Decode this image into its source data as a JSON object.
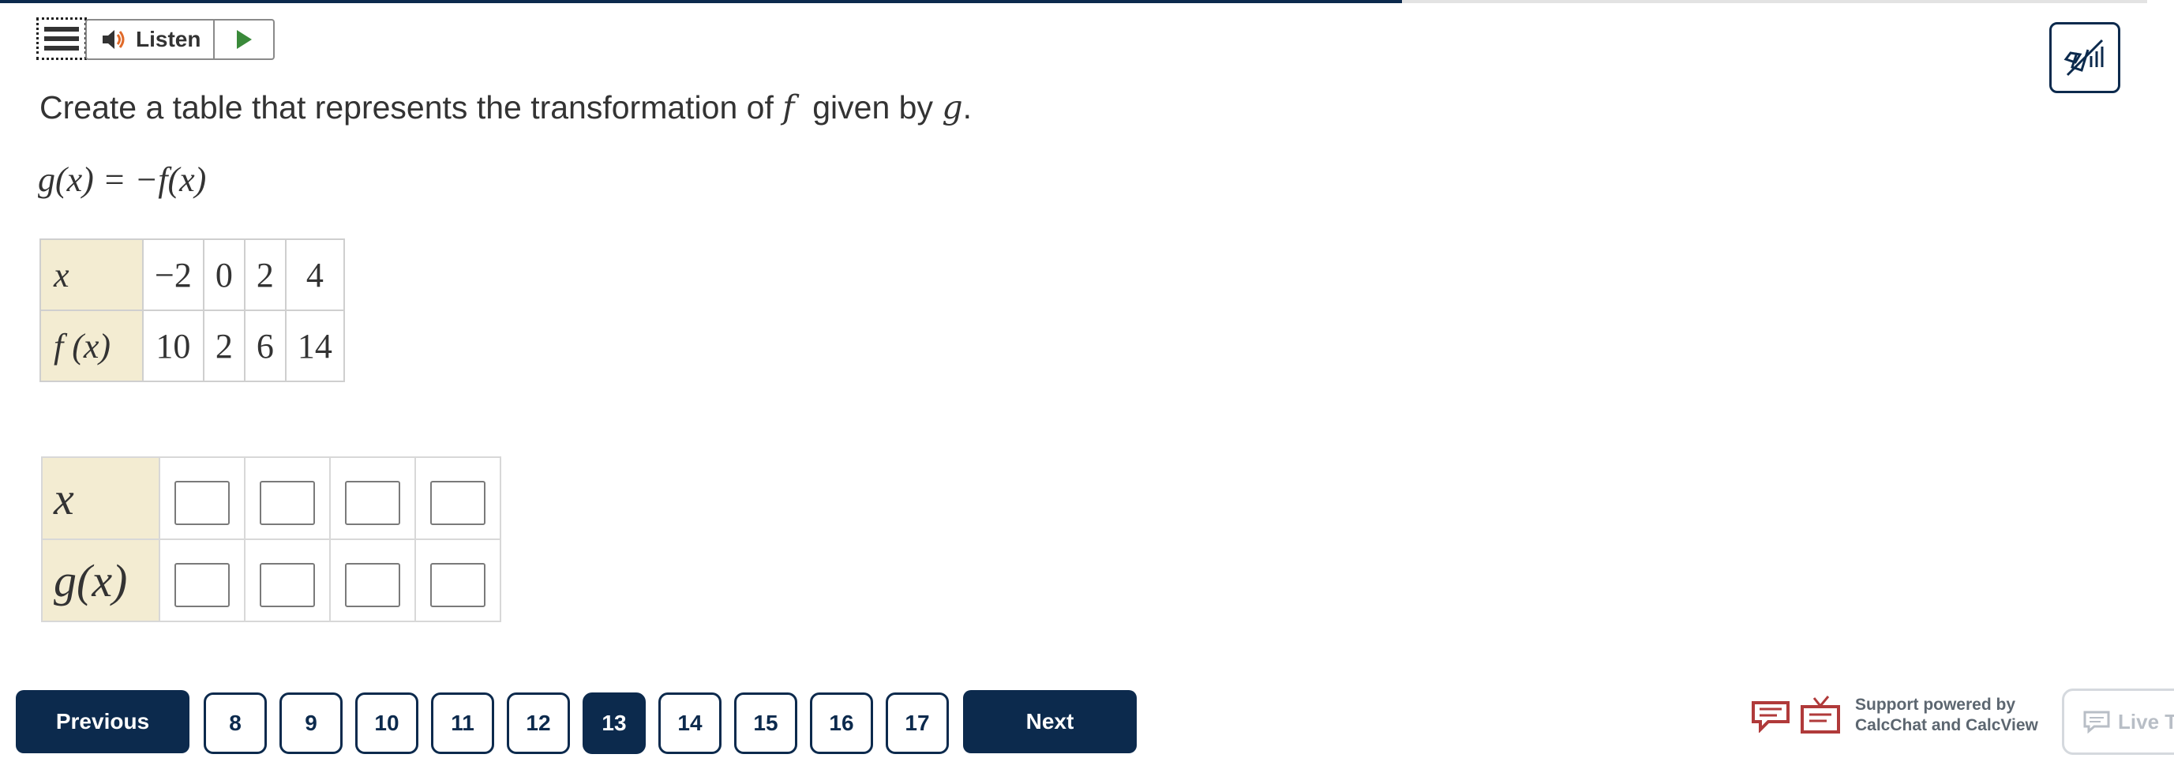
{
  "progress": {
    "fraction": 0.644
  },
  "toolbar": {
    "menu_icon": "hamburger-menu-icon",
    "listen_label": "Listen",
    "speaker_icon": "speaker-icon",
    "play_icon": "play-icon",
    "mute_icon": "mute-audio-icon"
  },
  "question": {
    "prefix": "Create a table that represents the transformation of",
    "f": "f",
    "middle": "given by",
    "g": "g",
    "suffix": "."
  },
  "equation": {
    "text": "g(x) = −f(x)"
  },
  "given_table": {
    "x_label": "x",
    "fx_label": "f (x)",
    "x_values": [
      "−2",
      "0",
      "2",
      "4"
    ],
    "fx_values": [
      "10",
      "2",
      "6",
      "14"
    ]
  },
  "answer_table": {
    "x_label": "x",
    "gx_label": "g(x)",
    "x_inputs": [
      "",
      "",
      "",
      ""
    ],
    "gx_inputs": [
      "",
      "",
      "",
      ""
    ]
  },
  "pagination": {
    "previous_label": "Previous",
    "next_label": "Next",
    "pages": [
      "8",
      "9",
      "10",
      "11",
      "12",
      "13",
      "14",
      "15",
      "16",
      "17"
    ],
    "current": "13"
  },
  "support": {
    "line1": "Support powered by",
    "line2": "CalcChat and CalcView",
    "calcchat_icon": "chat-bubble-icon",
    "calcview_icon": "tv-icon"
  },
  "live_tutor": {
    "label": "Live Tutor",
    "icon": "chat-icon"
  },
  "colors": {
    "navy": "#0c2a4d",
    "header_cell": "#f3ecd2",
    "support_red": "#b03a3a"
  }
}
